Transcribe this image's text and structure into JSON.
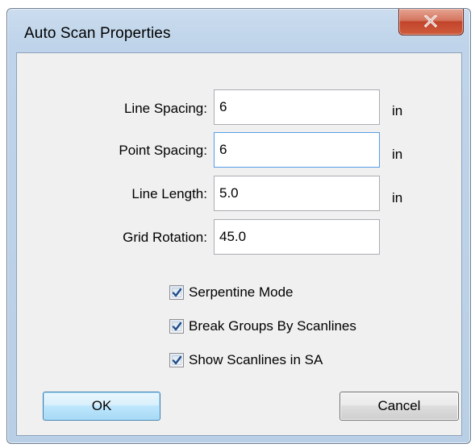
{
  "window": {
    "title": "Auto Scan Properties"
  },
  "fields": [
    {
      "label": "Line Spacing:",
      "value": "6",
      "unit": "in"
    },
    {
      "label": "Point Spacing:",
      "value": "6",
      "unit": "in"
    },
    {
      "label": "Line Length:",
      "value": "5.0",
      "unit": "in"
    },
    {
      "label": "Grid Rotation:",
      "value": "45.0",
      "unit": ""
    }
  ],
  "options": [
    {
      "label": "Serpentine Mode",
      "checked": true
    },
    {
      "label": "Break Groups By Scanlines",
      "checked": true
    },
    {
      "label": "Show Scanlines in SA",
      "checked": true
    }
  ],
  "buttons": {
    "ok": "OK",
    "cancel": "Cancel"
  },
  "icons": {
    "close": "close-icon",
    "check": "checkmark-icon"
  }
}
